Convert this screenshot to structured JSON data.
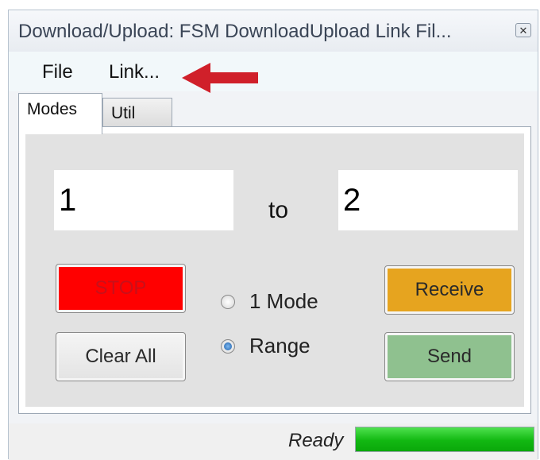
{
  "window": {
    "title": "Download/Upload: FSM DownloadUpload Link Fil...",
    "close_icon": "close-icon"
  },
  "menu": {
    "items": [
      "File",
      "Link..."
    ]
  },
  "annotation": {
    "arrow_color": "#d0202a",
    "icon": "arrow-left-icon"
  },
  "tabs": [
    {
      "label": "Modes",
      "selected": true
    },
    {
      "label": "Util",
      "selected": false
    }
  ],
  "modes_panel": {
    "from_value": "1",
    "to_label": "to",
    "to_value": "2",
    "buttons": {
      "stop": "STOP",
      "clear_all": "Clear All",
      "receive": "Receive",
      "send": "Send"
    },
    "radio_options": [
      {
        "label": "1 Mode",
        "selected": false
      },
      {
        "label": "Range",
        "selected": true
      }
    ]
  },
  "colors": {
    "stop": "#ff0000",
    "receive": "#e6a41f",
    "send": "#8fc18f",
    "progress": "#12b812"
  },
  "status": {
    "text": "Ready",
    "progress_fraction": 1.0
  }
}
